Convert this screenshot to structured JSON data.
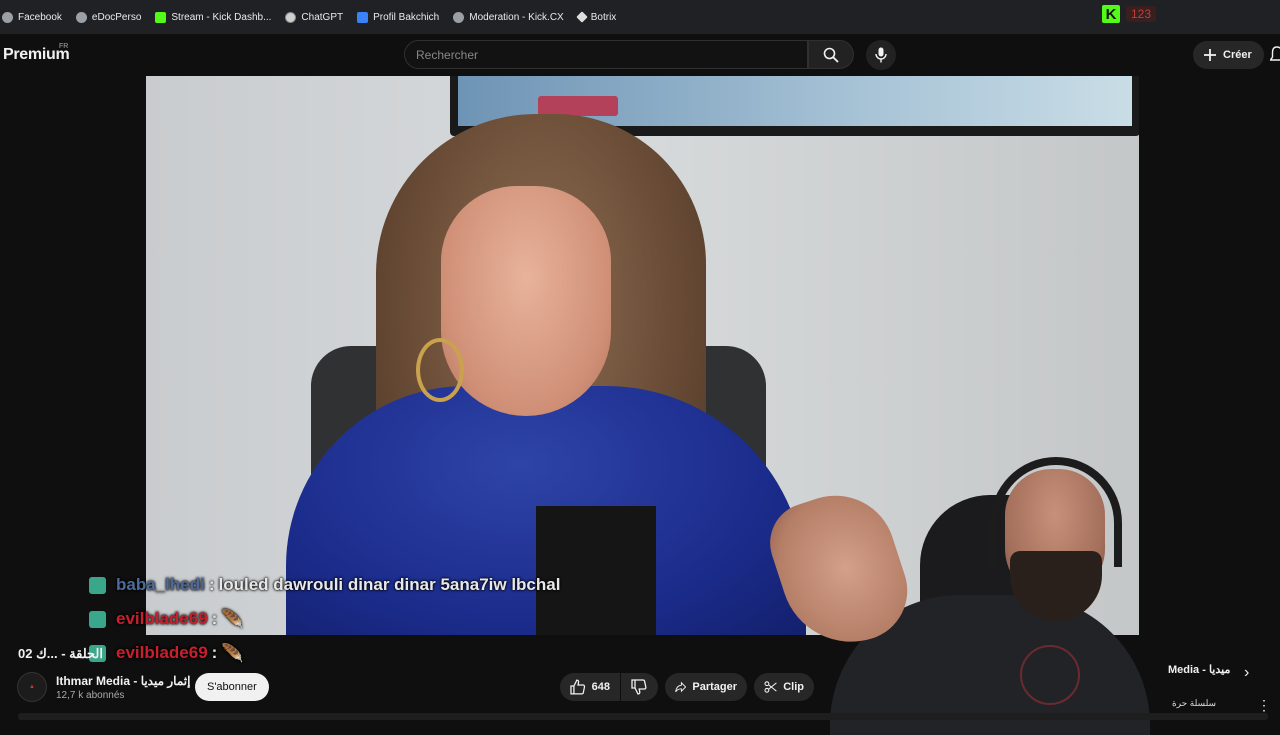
{
  "bookmarks": [
    {
      "label": "Facebook",
      "icon": "facebook-icon"
    },
    {
      "label": "eDocPerso",
      "icon": "globe-icon"
    },
    {
      "label": "Stream - Kick Dashb...",
      "icon": "kick-icon"
    },
    {
      "label": "ChatGPT",
      "icon": "openai-icon"
    },
    {
      "label": "Profil Bakchich",
      "icon": "profile-icon"
    },
    {
      "label": "Moderation - Kick.CX",
      "icon": "gear-icon"
    },
    {
      "label": "Botrix",
      "icon": "diamond-icon"
    }
  ],
  "kick_extension": {
    "logo": "K",
    "count": "123"
  },
  "header": {
    "logo": "Premium",
    "logo_region": "FR",
    "search_placeholder": "Rechercher",
    "create_label": "Créer"
  },
  "chat": [
    {
      "user": "baba_lhedi",
      "separator": ":",
      "message": "louled dawrouli dinar dinar 5ana7iw lbchal"
    },
    {
      "user": "evilblade69",
      "separator": ":",
      "message": "🪶"
    },
    {
      "user": "evilblade69",
      "separator": ":",
      "message": "🪶"
    }
  ],
  "video": {
    "title": "02 الحلقة - ...ك",
    "channel": "Ithmar Media - إثمار ميديا",
    "subscribers": "12,7 k abonnés",
    "subscribe_label": "S'abonner",
    "likes": "648",
    "share_label": "Partager",
    "clip_label": "Clip"
  },
  "side": {
    "title": "Media - ميديا",
    "subtitle": "سلسلة حرة"
  },
  "colors": {
    "kick_green": "#53fc18",
    "chat_user1": "#4e6a9b",
    "chat_user2": "#c8202e",
    "badge": "#3aa78a"
  }
}
